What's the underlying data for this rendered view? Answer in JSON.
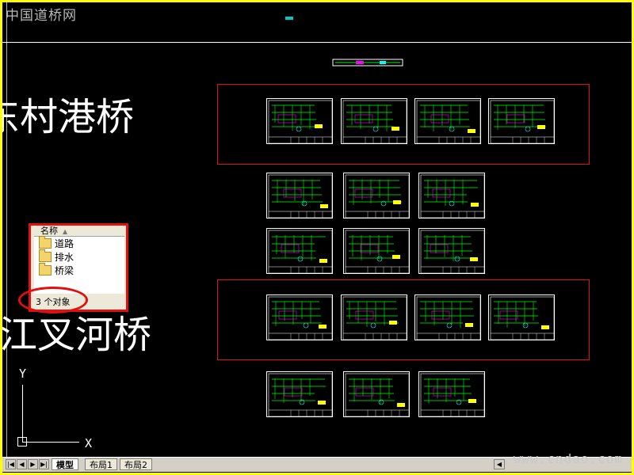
{
  "watermarks": {
    "top": "中国道桥网",
    "bottom": "www.cndao.com"
  },
  "drawing": {
    "title_1": "东村港桥",
    "title_2": "江叉河桥"
  },
  "file_panel": {
    "column_header": "名称",
    "folders": [
      "道路",
      "排水",
      "桥梁"
    ],
    "status": "3 个对象"
  },
  "ucs": {
    "y_label": "Y",
    "x_label": "X"
  },
  "tabs": {
    "items": [
      "模型",
      "布局1",
      "布局2"
    ],
    "active": "模型"
  },
  "colors": {
    "canvas": "#000000",
    "frame": "#ffff00",
    "highlight": "#e01010",
    "sheet_line": "#00ff00",
    "sheet_accent": "#ffff00"
  }
}
